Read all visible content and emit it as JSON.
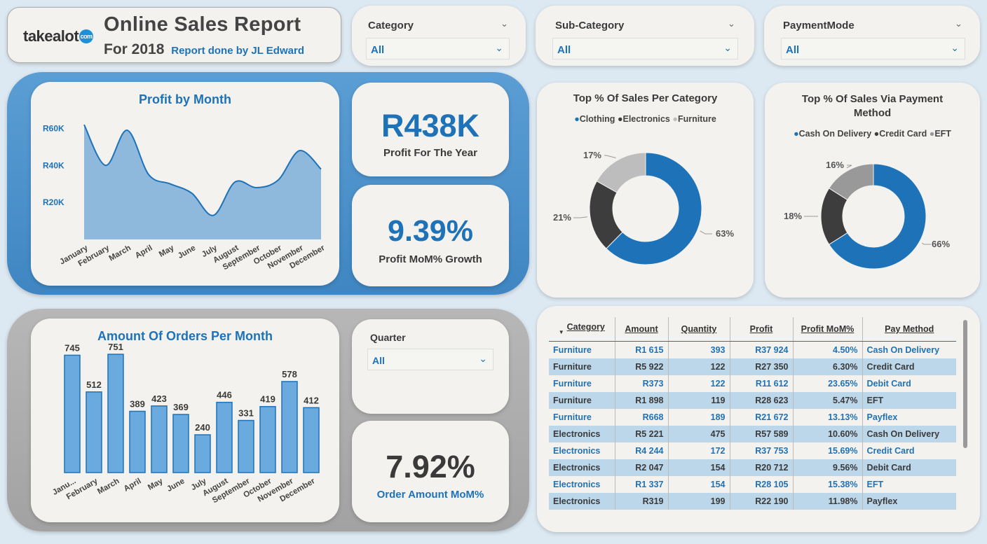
{
  "header": {
    "logo_text": "takealot",
    "logo_badge": "com",
    "title": "Online Sales Report",
    "subtitle": "For 2018",
    "byline": "Report done by JL Edward"
  },
  "slicers": {
    "category": {
      "label": "Category",
      "value": "All"
    },
    "subcategory": {
      "label": "Sub-Category",
      "value": "All"
    },
    "paymentmode": {
      "label": "PaymentMode",
      "value": "All"
    },
    "quarter": {
      "label": "Quarter",
      "value": "All"
    }
  },
  "kpis": {
    "profit_year": {
      "value": "R438K",
      "label": "Profit For The Year"
    },
    "profit_mom": {
      "value": "9.39%",
      "label": "Profit MoM% Growth"
    },
    "order_mom": {
      "value": "7.92%",
      "label": "Order Amount MoM%"
    }
  },
  "icons": {
    "dropdown": "chevron-down-icon",
    "sort": "sort-down-icon"
  },
  "colors": {
    "accent": "#1e72b8",
    "electronics": "#3d3d3d",
    "furniture": "#bdbdbd",
    "eft": "#999999"
  },
  "chart_data": [
    {
      "type": "area",
      "title": "Profit by Month",
      "categories": [
        "January",
        "February",
        "March",
        "April",
        "May",
        "June",
        "July",
        "August",
        "September",
        "October",
        "November",
        "December"
      ],
      "values": [
        62000,
        40000,
        59000,
        35000,
        30000,
        25000,
        13000,
        31000,
        28000,
        32000,
        48000,
        38000
      ],
      "y_ticks": [
        "R20K",
        "R40K",
        "R60K"
      ],
      "ylim": [
        0,
        70000
      ]
    },
    {
      "type": "bar",
      "title": "Amount Of Orders Per Month",
      "categories": [
        "Janu...",
        "February",
        "March",
        "April",
        "May",
        "June",
        "July",
        "August",
        "September",
        "October",
        "November",
        "December"
      ],
      "values": [
        745,
        512,
        751,
        389,
        423,
        369,
        240,
        446,
        331,
        419,
        578,
        412
      ],
      "ylim": [
        0,
        800
      ]
    },
    {
      "type": "pie",
      "title": "Top % Of Sales Per Category",
      "legend": [
        "Clothing",
        "Electronics",
        "Furniture"
      ],
      "values": [
        63,
        21,
        17
      ],
      "labels": [
        "63%",
        "21%",
        "17%"
      ]
    },
    {
      "type": "pie",
      "title": "Top % Of Sales Via Payment Method",
      "legend": [
        "Cash On Delivery",
        "Credit Card",
        "EFT"
      ],
      "values": [
        66,
        18,
        16
      ],
      "labels": [
        "66%",
        "18%",
        "16%"
      ]
    }
  ],
  "table": {
    "headers": [
      "Category",
      "Amount",
      "Quantity",
      "Profit",
      "Profit MoM%",
      "Pay Method"
    ],
    "rows": [
      [
        "Furniture",
        "R1 615",
        "393",
        "R37 924",
        "4.50%",
        "Cash On Delivery"
      ],
      [
        "Furniture",
        "R5 922",
        "122",
        "R27 350",
        "6.30%",
        "Credit Card"
      ],
      [
        "Furniture",
        "R373",
        "122",
        "R11 612",
        "23.65%",
        "Debit Card"
      ],
      [
        "Furniture",
        "R1 898",
        "119",
        "R28 623",
        "5.47%",
        "EFT"
      ],
      [
        "Furniture",
        "R668",
        "189",
        "R21 672",
        "13.13%",
        "Payflex"
      ],
      [
        "Electronics",
        "R5 221",
        "475",
        "R57 589",
        "10.60%",
        "Cash On Delivery"
      ],
      [
        "Electronics",
        "R4 244",
        "172",
        "R37 753",
        "15.69%",
        "Credit Card"
      ],
      [
        "Electronics",
        "R2 047",
        "154",
        "R20 712",
        "9.56%",
        "Debit Card"
      ],
      [
        "Electronics",
        "R1 337",
        "154",
        "R28 105",
        "15.38%",
        "EFT"
      ],
      [
        "Electronics",
        "R319",
        "199",
        "R22 190",
        "11.98%",
        "Payflex"
      ]
    ]
  }
}
